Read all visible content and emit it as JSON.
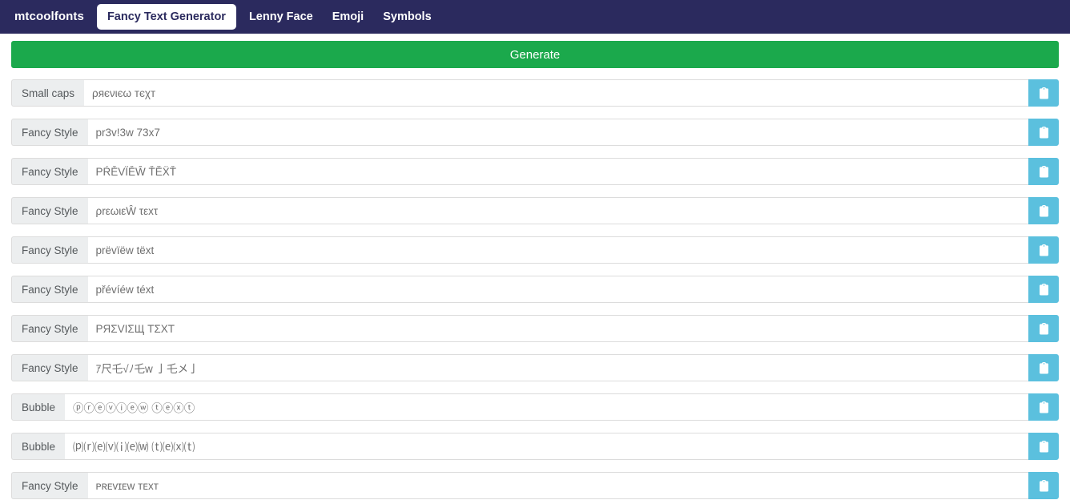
{
  "navbar": {
    "brand": "mtcoolfonts",
    "items": [
      {
        "label": "Fancy Text Generator",
        "active": true
      },
      {
        "label": "Lenny Face",
        "active": false
      },
      {
        "label": "Emoji",
        "active": false
      },
      {
        "label": "Symbols",
        "active": false
      }
    ],
    "background_color": "#2b2a5e",
    "active_text_color": "#2b2a5e"
  },
  "toolbar": {
    "generate_label": "Generate",
    "generate_color": "#1ba94c"
  },
  "results": {
    "copy_icon": "clipboard-icon",
    "copy_button_color": "#5bc0de",
    "rows": [
      {
        "label": "Small caps",
        "value": "ρяєνιєω тєχт"
      },
      {
        "label": "Fancy Style",
        "value": "pr3v!3w 73x7"
      },
      {
        "label": "Fancy Style",
        "value": "PŔĚVÏĚŴ ŤĔẌŤ"
      },
      {
        "label": "Fancy Style",
        "value": "ρrεωιεŴ τεxτ"
      },
      {
        "label": "Fancy Style",
        "value": "prëvïëw tëxt"
      },
      {
        "label": "Fancy Style",
        "value": "přévíéw téxt"
      },
      {
        "label": "Fancy Style",
        "value": "ΡЯΣVIΣЩ ΤΣXΤ"
      },
      {
        "label": "Fancy Style",
        "value": "ｱ尺乇√ﾉ乇w 亅乇メ亅"
      },
      {
        "label": "Bubble",
        "value": "ⓟⓡⓔⓥⓘⓔⓦ ⓣⓔⓧⓣ"
      },
      {
        "label": "Bubble",
        "value": "⒫⒭⒠⒱⒤⒠⒲ ⒯⒠⒳⒯"
      },
      {
        "label": "Fancy Style",
        "value": "ᴘʀᴇᴠɪᴇᴡ ᴛᴇxᴛ"
      }
    ]
  }
}
